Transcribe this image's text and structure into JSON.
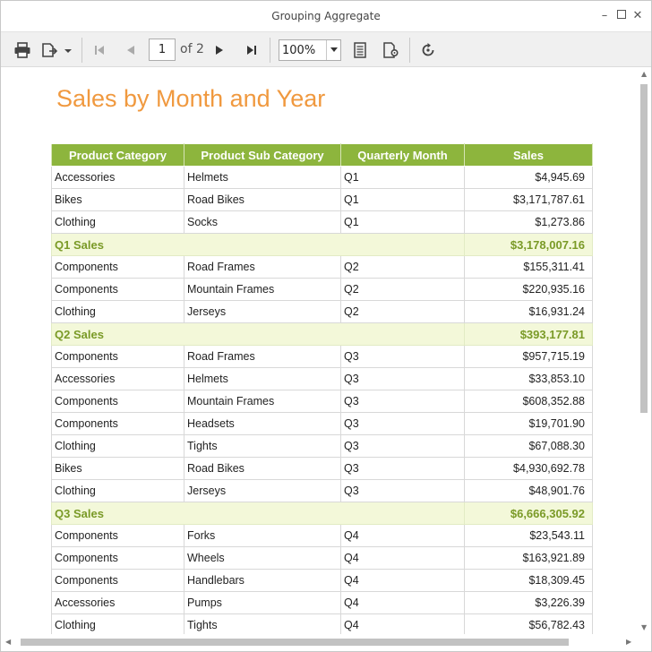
{
  "window": {
    "title": "Grouping Aggregate"
  },
  "toolbar": {
    "page_current": "1",
    "page_of": "of 2",
    "zoom": "100%"
  },
  "report": {
    "title": "Sales by Month and Year",
    "columns": [
      "Product Category",
      "Product Sub Category",
      "Quarterly Month",
      "Sales"
    ],
    "rows": [
      {
        "type": "data",
        "category": "Accessories",
        "sub": "Helmets",
        "month": "Q1",
        "sales": "$4,945.69"
      },
      {
        "type": "data",
        "category": "Bikes",
        "sub": "Road Bikes",
        "month": "Q1",
        "sales": "$3,171,787.61"
      },
      {
        "type": "data",
        "category": "Clothing",
        "sub": "Socks",
        "month": "Q1",
        "sales": "$1,273.86"
      },
      {
        "type": "subtotal",
        "label": "Q1 Sales",
        "sales": "$3,178,007.16"
      },
      {
        "type": "data",
        "category": "Components",
        "sub": "Road Frames",
        "month": "Q2",
        "sales": "$155,311.41"
      },
      {
        "type": "data",
        "category": "Components",
        "sub": "Mountain Frames",
        "month": "Q2",
        "sales": "$220,935.16"
      },
      {
        "type": "data",
        "category": "Clothing",
        "sub": "Jerseys",
        "month": "Q2",
        "sales": "$16,931.24"
      },
      {
        "type": "subtotal",
        "label": "Q2 Sales",
        "sales": "$393,177.81"
      },
      {
        "type": "data",
        "category": "Components",
        "sub": "Road Frames",
        "month": "Q3",
        "sales": "$957,715.19"
      },
      {
        "type": "data",
        "category": "Accessories",
        "sub": "Helmets",
        "month": "Q3",
        "sales": "$33,853.10"
      },
      {
        "type": "data",
        "category": "Components",
        "sub": "Mountain Frames",
        "month": "Q3",
        "sales": "$608,352.88"
      },
      {
        "type": "data",
        "category": "Components",
        "sub": "Headsets",
        "month": "Q3",
        "sales": "$19,701.90"
      },
      {
        "type": "data",
        "category": "Clothing",
        "sub": "Tights",
        "month": "Q3",
        "sales": "$67,088.30"
      },
      {
        "type": "data",
        "category": "Bikes",
        "sub": "Road Bikes",
        "month": "Q3",
        "sales": "$4,930,692.78"
      },
      {
        "type": "data",
        "category": "Clothing",
        "sub": "Jerseys",
        "month": "Q3",
        "sales": "$48,901.76"
      },
      {
        "type": "subtotal",
        "label": "Q3 Sales",
        "sales": "$6,666,305.92"
      },
      {
        "type": "data",
        "category": "Components",
        "sub": "Forks",
        "month": "Q4",
        "sales": "$23,543.11"
      },
      {
        "type": "data",
        "category": "Components",
        "sub": "Wheels",
        "month": "Q4",
        "sales": "$163,921.89"
      },
      {
        "type": "data",
        "category": "Components",
        "sub": "Handlebars",
        "month": "Q4",
        "sales": "$18,309.45"
      },
      {
        "type": "data",
        "category": "Accessories",
        "sub": "Pumps",
        "month": "Q4",
        "sales": "$3,226.39"
      },
      {
        "type": "data",
        "category": "Clothing",
        "sub": "Tights",
        "month": "Q4",
        "sales": "$56,782.43"
      }
    ]
  },
  "colors": {
    "title_orange": "#f0993f",
    "header_green": "#8db53d",
    "subtotal_bg": "#f3f8d9",
    "subtotal_text": "#7a9a27"
  },
  "icons": [
    "print-icon",
    "export-icon",
    "first-page-icon",
    "previous-page-icon",
    "next-page-icon",
    "last-page-icon",
    "page-setup-icon",
    "print-layout-icon",
    "refresh-icon",
    "minimize-icon",
    "maximize-icon",
    "close-icon"
  ]
}
